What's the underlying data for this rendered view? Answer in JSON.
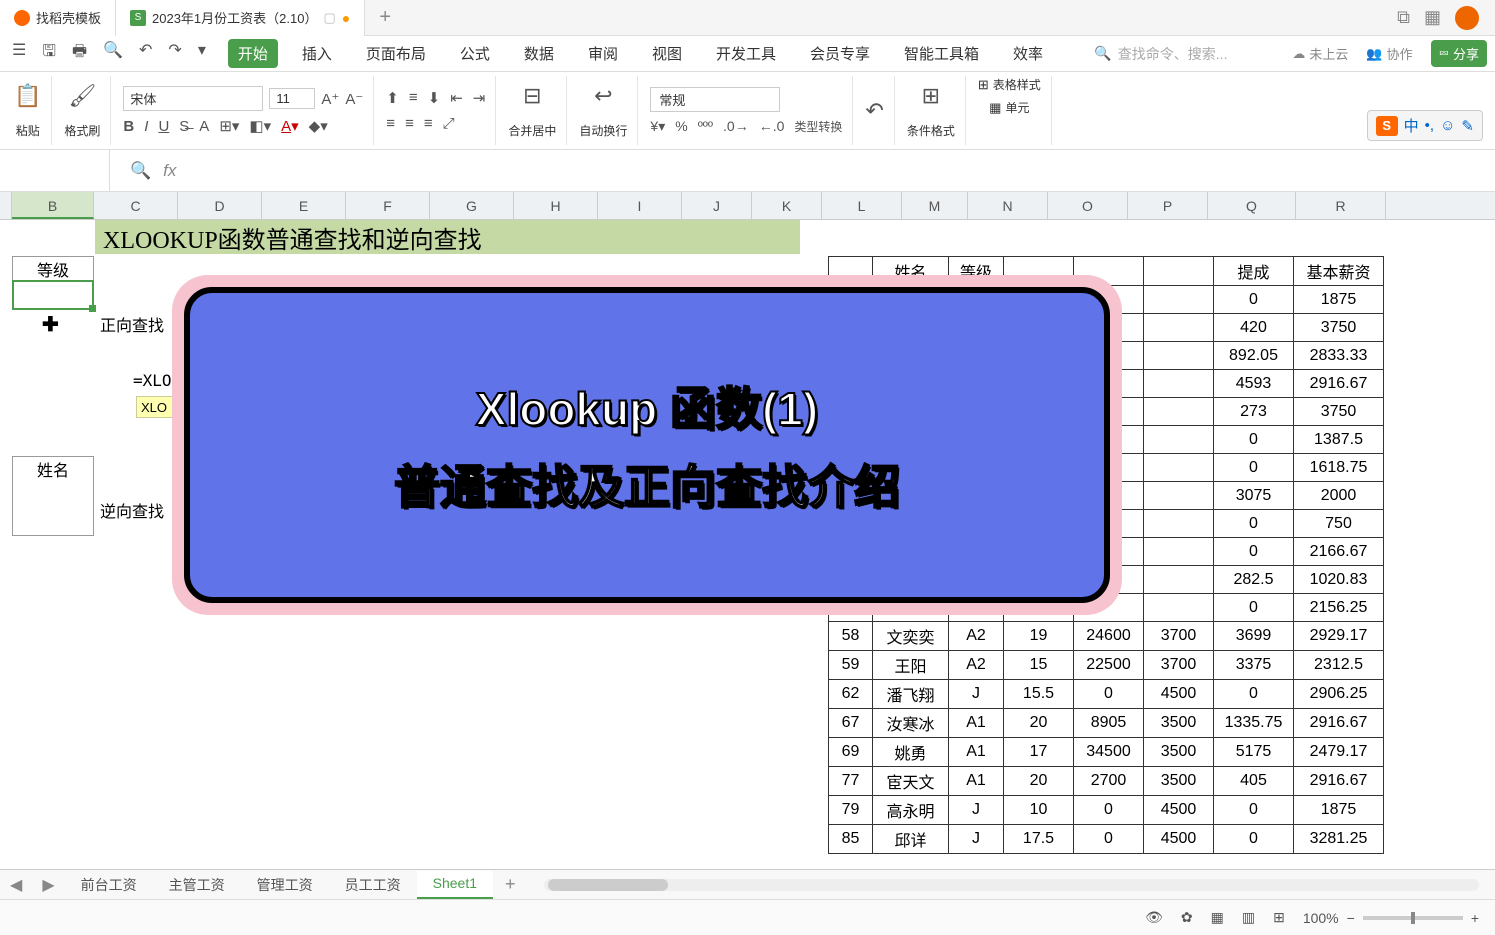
{
  "tabs": {
    "t1": "找稻壳模板",
    "t2": "2023年1月份工资表（2.10）"
  },
  "ribbon": {
    "start": "开始",
    "insert": "插入",
    "layout": "页面布局",
    "formula": "公式",
    "data": "数据",
    "review": "审阅",
    "view": "视图",
    "dev": "开发工具",
    "member": "会员专享",
    "smart": "智能工具箱",
    "eff": "效率",
    "search_ph": "查找命令、搜索...",
    "cloud": "未上云",
    "collab": "协作",
    "share": "分享",
    "paste": "粘贴",
    "brush": "格式刷",
    "font": "宋体",
    "size": "11",
    "merge": "合并居中",
    "wrap": "自动换行",
    "numfmt": "常规",
    "typeconv": "类型转换",
    "condfmt": "条件格式",
    "tablestyle": "表格样式",
    "cell": "单元"
  },
  "ime": {
    "zh": "中"
  },
  "cols": {
    "B": "B",
    "C": "C",
    "D": "D",
    "E": "E",
    "F": "F",
    "G": "G",
    "H": "H",
    "I": "I",
    "J": "J",
    "K": "K",
    "L": "L",
    "M": "M",
    "N": "N",
    "O": "O",
    "P": "P",
    "Q": "Q",
    "R": "R"
  },
  "sheet": {
    "title": "XLOOKUP函数普通查找和逆向查找",
    "level": "等级",
    "forward": "正向查找",
    "xlo": "=XLO",
    "xhint": "XLO",
    "name": "姓名",
    "reverse": "逆向查找"
  },
  "overlay": {
    "l1": "Xlookup 函数(1)",
    "l2": "普通查找及正向查找介绍"
  },
  "rtable": {
    "headers": [
      "",
      "姓名",
      "等级",
      "",
      "",
      "",
      "提成",
      "基本薪资"
    ],
    "rows": [
      [
        "",
        "",
        "",
        "",
        "",
        "",
        "0",
        "1875"
      ],
      [
        "",
        "",
        "",
        "",
        "",
        "",
        "420",
        "3750"
      ],
      [
        "",
        "",
        "",
        "",
        "",
        "",
        "892.05",
        "2833.33"
      ],
      [
        "",
        "",
        "",
        "",
        "",
        "",
        "4593",
        "2916.67"
      ],
      [
        "",
        "",
        "",
        "",
        "",
        "",
        "273",
        "3750"
      ],
      [
        "",
        "",
        "",
        "",
        "",
        "",
        "0",
        "1387.5"
      ],
      [
        "",
        "",
        "",
        "",
        "",
        "",
        "0",
        "1618.75"
      ],
      [
        "",
        "",
        "",
        "",
        "",
        "",
        "3075",
        "2000"
      ],
      [
        "",
        "",
        "",
        "",
        "",
        "",
        "0",
        "750"
      ],
      [
        "",
        "",
        "",
        "",
        "",
        "",
        "0",
        "2166.67"
      ],
      [
        "",
        "",
        "",
        "",
        "",
        "",
        "282.5",
        "1020.83"
      ],
      [
        "",
        "",
        "",
        "",
        "",
        "",
        "0",
        "2156.25"
      ],
      [
        "58",
        "文奕奕",
        "A2",
        "19",
        "24600",
        "3700",
        "3699",
        "2929.17"
      ],
      [
        "59",
        "王阳",
        "A2",
        "15",
        "22500",
        "3700",
        "3375",
        "2312.5"
      ],
      [
        "62",
        "潘飞翔",
        "J",
        "15.5",
        "0",
        "4500",
        "0",
        "2906.25"
      ],
      [
        "67",
        "汝寒冰",
        "A1",
        "20",
        "8905",
        "3500",
        "1335.75",
        "2916.67"
      ],
      [
        "69",
        "姚勇",
        "A1",
        "17",
        "34500",
        "3500",
        "5175",
        "2479.17"
      ],
      [
        "77",
        "宦天文",
        "A1",
        "20",
        "2700",
        "3500",
        "405",
        "2916.67"
      ],
      [
        "79",
        "高永明",
        "J",
        "10",
        "0",
        "4500",
        "0",
        "1875"
      ],
      [
        "85",
        "邱详",
        "J",
        "17.5",
        "0",
        "4500",
        "0",
        "3281.25"
      ]
    ]
  },
  "sheets": [
    "前台工资",
    "主管工资",
    "管理工资",
    "员工工资",
    "Sheet1"
  ],
  "status": {
    "zoom": "100%"
  }
}
